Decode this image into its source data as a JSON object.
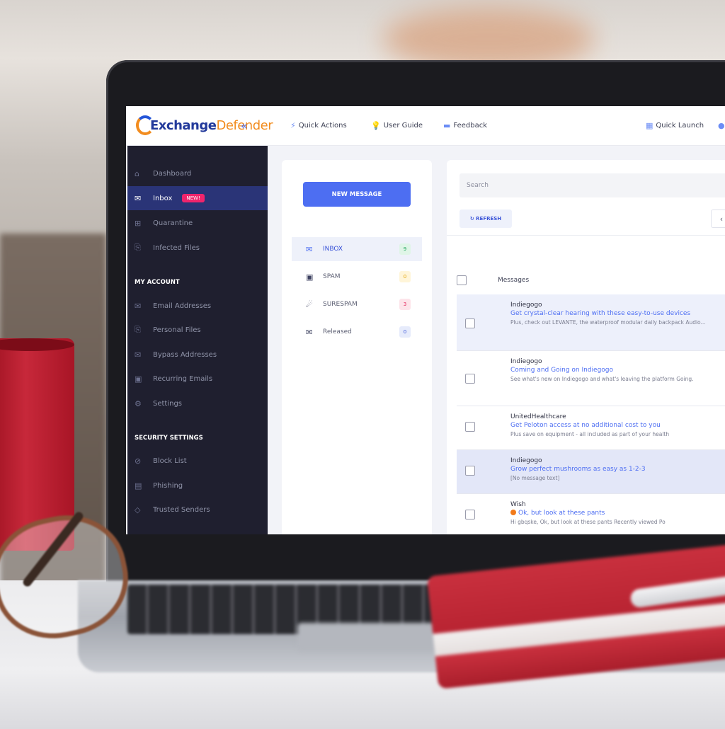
{
  "app": {
    "logo_part1": "Exchange",
    "logo_part2": "Defender",
    "collapse_icon": "double-chevron-left-icon"
  },
  "topnav": {
    "quick_actions": "Quick Actions",
    "user_guide": "User Guide",
    "feedback": "Feedback",
    "quick_launch": "Quick Launch"
  },
  "sidebar": {
    "items": [
      {
        "label": "Dashboard",
        "icon": "home-icon"
      },
      {
        "label": "Inbox",
        "icon": "envelope-icon",
        "badge": "NEW!"
      },
      {
        "label": "Quarantine",
        "icon": "quarantine-icon"
      },
      {
        "label": "Infected Files",
        "icon": "file-icon"
      }
    ],
    "my_account_heading": "MY ACCOUNT",
    "account_items": [
      {
        "label": "Email Addresses"
      },
      {
        "label": "Personal Files"
      },
      {
        "label": "Bypass Addresses"
      },
      {
        "label": "Recurring Emails"
      },
      {
        "label": "Settings"
      }
    ],
    "security_heading": "SECURITY SETTINGS",
    "security_items": [
      {
        "label": "Block List"
      },
      {
        "label": "Phishing"
      },
      {
        "label": "Trusted Senders"
      }
    ]
  },
  "folders": {
    "new_message": "NEW MESSAGE",
    "items": [
      {
        "label": "INBOX",
        "count": "9"
      },
      {
        "label": "SPAM",
        "count": "0"
      },
      {
        "label": "SURESPAM",
        "count": "3"
      },
      {
        "label": "Released",
        "count": "0"
      }
    ]
  },
  "messages": {
    "search_placeholder": "Search",
    "refresh": "REFRESH",
    "column_header": "Messages",
    "rows": [
      {
        "from": "Indiegogo",
        "subject": "Get crystal-clear hearing with these easy-to-use devices",
        "preview": "Plus, check out LEVANTE, the waterproof modular daily backpack Audio..."
      },
      {
        "from": "Indiegogo",
        "subject": "Coming and Going on Indiegogo",
        "preview": "See what's new on Indiegogo and what's leaving the platform Going."
      },
      {
        "from": "UnitedHealthcare",
        "subject": "Get Peloton access at no additional cost to you",
        "preview": "Plus save on equipment - all included as part of your health"
      },
      {
        "from": "Indiegogo",
        "subject": "Grow perfect mushrooms as easy as 1-2-3",
        "preview": "[No message text]"
      },
      {
        "from": "Wish",
        "subject": "Ok, but look at these pants",
        "preview": "Hi gbqske, Ok, but look at these pants Recently viewed Po"
      }
    ]
  },
  "colors": {
    "accent": "#4d6ef2",
    "sidebar_bg": "#1f1f2f",
    "badge_new": "#f0246c",
    "logo_orange": "#f28c1e"
  }
}
